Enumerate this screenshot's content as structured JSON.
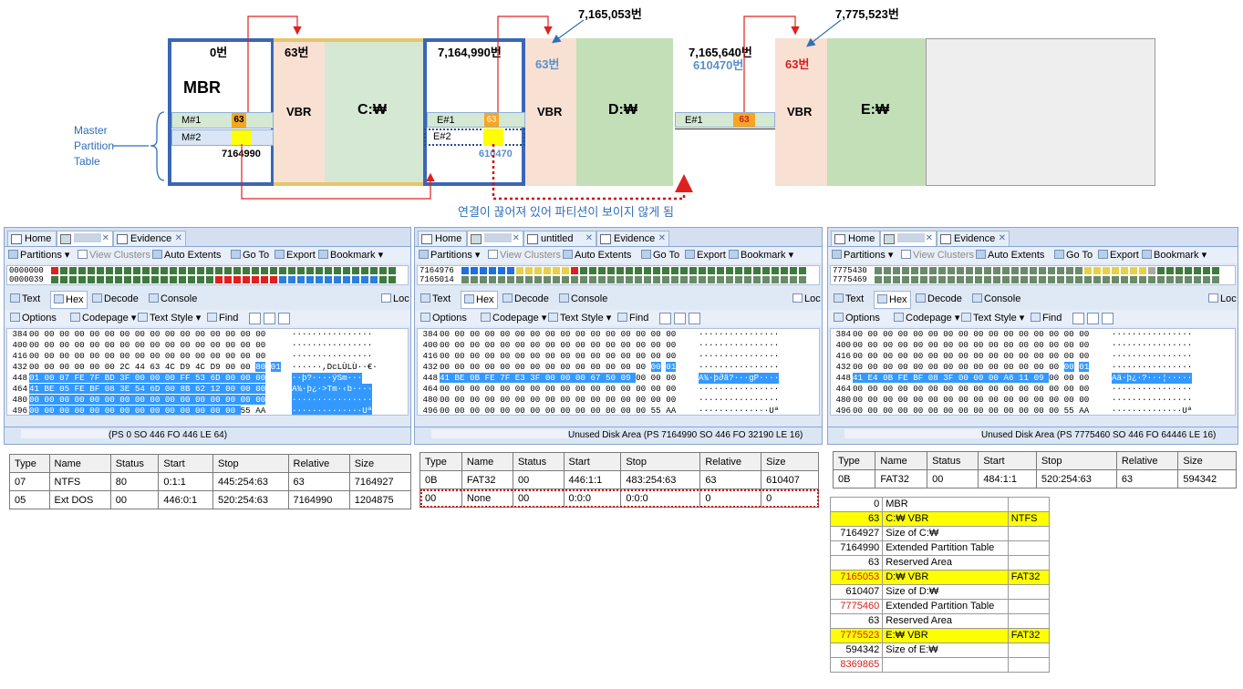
{
  "diagram": {
    "seg1_sector": "0번",
    "mbr_label": "MBR",
    "m1": "M#1",
    "m1_val": "63",
    "m2": "M#2",
    "m2_val": "7164990",
    "master_partition_table": [
      "Master",
      "Partition",
      "Table"
    ],
    "vbr1_sector": "63번",
    "vbr": "VBR",
    "c_drive": "C:₩",
    "seg2_sector": "7,164,990번",
    "e1": "E#1",
    "e1_val": "63",
    "e2": "E#2",
    "e2_val": "610470",
    "d_sector_top": "7,165,053번",
    "d_sector_rel": "63번",
    "d_drive": "D:₩",
    "seg3_sector": "7,165,640번",
    "seg3_rel": "610470번",
    "e1b": "E#1",
    "e1b_val": "63",
    "e_sector_top": "7,775,523번",
    "e_sector_rel": "63번",
    "e_drive": "E:₩",
    "caption": "연결이 끊어져 있어 파티션이 보이지 않게 됨",
    "colors": {
      "frame": "#3a66b5",
      "vbr": "#f8e0d3",
      "drive": "#d5e8d4",
      "green_drive": "#c3dfb8",
      "orange": "#f5a623",
      "yellow": "#ffff00",
      "arrow": "#e02020"
    }
  },
  "panels": [
    {
      "tabs": [
        "Home",
        "",
        "Evidence"
      ],
      "toolbar": [
        "Partitions",
        "View Clusters",
        "Auto Extents",
        "Go To",
        "Export",
        "Bookmark"
      ],
      "map_offsets": [
        "0000000",
        "0000039"
      ],
      "view_tabs": [
        "Text",
        "Hex",
        "Decode",
        "Console",
        "Loc"
      ],
      "hex_toolbar": [
        "Options",
        "Codepage",
        "Text Style",
        "Find"
      ],
      "hex_rows": [
        {
          "off": "384",
          "bytes": "00 00 00 00 00 00 00 00 00 00 00 00 00 00 00 00",
          "ascii": "················",
          "hl": "none"
        },
        {
          "off": "400",
          "bytes": "00 00 00 00 00 00 00 00 00 00 00 00 00 00 00 00",
          "ascii": "················",
          "hl": "none"
        },
        {
          "off": "416",
          "bytes": "00 00 00 00 00 00 00 00 00 00 00 00 00 00 00 00",
          "ascii": "················",
          "hl": "none"
        },
        {
          "off": "432",
          "bytes": "00 00 00 00 00 00 2C 44 63 4C D9 4C D9 00 00 80 01",
          "ascii": "······,DcLÙLÙ··€·",
          "hl": "tail"
        },
        {
          "off": "448",
          "bytes": "01 00 07 FE 7F BD 3F 00 00 00 FF 53 6D 00 00 00",
          "ascii": "··þ?····ÿSm···",
          "hl": "full"
        },
        {
          "off": "464",
          "bytes": "41 BE 05 FE BF 08 3E 54 6D 00 8B 62 12 00 00 00",
          "ascii": "A¾·þ¿·>Tm·‹b····",
          "hl": "full"
        },
        {
          "off": "480",
          "bytes": "00 00 00 00 00 00 00 00 00 00 00 00 00 00 00 00",
          "ascii": "················",
          "hl": "full"
        },
        {
          "off": "496",
          "bytes": "00 00 00 00 00 00 00 00 00 00 00 00 00 00 55 AA",
          "ascii": "··············Uª",
          "hl": "head"
        }
      ],
      "status": "(PS 0 SO 446 FO 446 LE 64)",
      "table": {
        "headers": [
          "Type",
          "Name",
          "Status",
          "Start",
          "Stop",
          "Relative",
          "Size"
        ],
        "rows": [
          [
            "07",
            "NTFS",
            "80",
            "0:1:1",
            "445:254:63",
            "63",
            "7164927"
          ],
          [
            "05",
            "Ext DOS",
            "00",
            "446:0:1",
            "520:254:63",
            "7164990",
            "1204875"
          ]
        ]
      }
    },
    {
      "tabs": [
        "Home",
        "",
        "untitled",
        "Evidence"
      ],
      "toolbar": [
        "Partitions",
        "View Clusters",
        "Auto Extents",
        "Go To",
        "Export",
        "Bookmark"
      ],
      "map_offsets": [
        "7164976",
        "7165014"
      ],
      "view_tabs": [
        "Text",
        "Hex",
        "Decode",
        "Console",
        "Loc"
      ],
      "hex_toolbar": [
        "Options",
        "Codepage",
        "Text Style",
        "Find"
      ],
      "hex_rows": [
        {
          "off": "384",
          "bytes": "00 00 00 00 00 00 00 00 00 00 00 00 00 00 00 00",
          "ascii": "················",
          "hl": "none"
        },
        {
          "off": "400",
          "bytes": "00 00 00 00 00 00 00 00 00 00 00 00 00 00 00 00",
          "ascii": "················",
          "hl": "none"
        },
        {
          "off": "416",
          "bytes": "00 00 00 00 00 00 00 00 00 00 00 00 00 00 00 00",
          "ascii": "················",
          "hl": "none"
        },
        {
          "off": "432",
          "bytes": "00 00 00 00 00 00 00 00 00 00 00 00 00 00 00 01",
          "ascii": "················",
          "hl": "tail"
        },
        {
          "off": "448",
          "bytes": "41 BE 0B FE 7F E3 3F 00 00 00 67 50 09 00 00 00",
          "ascii": "A¾·þ∂ã?···gP····",
          "hl": "part"
        },
        {
          "off": "464",
          "bytes": "00 00 00 00 00 00 00 00 00 00 00 00 00 00 00 00",
          "ascii": "················",
          "hl": "none"
        },
        {
          "off": "480",
          "bytes": "00 00 00 00 00 00 00 00 00 00 00 00 00 00 00 00",
          "ascii": "················",
          "hl": "none"
        },
        {
          "off": "496",
          "bytes": "00 00 00 00 00 00 00 00 00 00 00 00 00 00 55 AA",
          "ascii": "··············Uª",
          "hl": "none"
        }
      ],
      "status": "Unused Disk Area (PS 7164990 SO 446 FO 32190 LE 16)",
      "table": {
        "headers": [
          "Type",
          "Name",
          "Status",
          "Start",
          "Stop",
          "Relative",
          "Size"
        ],
        "rows": [
          [
            "0B",
            "FAT32",
            "00",
            "446:1:1",
            "483:254:63",
            "63",
            "610407"
          ],
          [
            "00",
            "None",
            "00",
            "0:0:0",
            "0:0:0",
            "0",
            "0"
          ]
        ]
      }
    },
    {
      "tabs": [
        "Home",
        "",
        "Evidence"
      ],
      "toolbar": [
        "Partitions",
        "View Clusters",
        "Auto Extents",
        "Go To",
        "Export",
        "Bookmark"
      ],
      "map_offsets": [
        "7775430",
        "7775469"
      ],
      "view_tabs": [
        "Text",
        "Hex",
        "Decode",
        "Console",
        "Loc"
      ],
      "hex_toolbar": [
        "Options",
        "Codepage",
        "Text Style",
        "Find"
      ],
      "hex_rows": [
        {
          "off": "384",
          "bytes": "00 00 00 00 00 00 00 00 00 00 00 00 00 00 00 00",
          "ascii": "················",
          "hl": "none"
        },
        {
          "off": "400",
          "bytes": "00 00 00 00 00 00 00 00 00 00 00 00 00 00 00 00",
          "ascii": "················",
          "hl": "none"
        },
        {
          "off": "416",
          "bytes": "00 00 00 00 00 00 00 00 00 00 00 00 00 00 00 00",
          "ascii": "················",
          "hl": "none"
        },
        {
          "off": "432",
          "bytes": "00 00 00 00 00 00 00 00 00 00 00 00 00 00 00 01",
          "ascii": "················",
          "hl": "tail"
        },
        {
          "off": "448",
          "bytes": "41 E4 0B FE BF 08 3F 00 00 00 A6 11 09 00 00 00",
          "ascii": "Aä·þ¿·?···¦·····",
          "hl": "part"
        },
        {
          "off": "464",
          "bytes": "00 00 00 00 00 00 00 00 00 00 00 00 00 00 00 00",
          "ascii": "················",
          "hl": "none"
        },
        {
          "off": "480",
          "bytes": "00 00 00 00 00 00 00 00 00 00 00 00 00 00 00 00",
          "ascii": "················",
          "hl": "none"
        },
        {
          "off": "496",
          "bytes": "00 00 00 00 00 00 00 00 00 00 00 00 00 00 55 AA",
          "ascii": "··············Uª",
          "hl": "none"
        }
      ],
      "status": "Unused Disk Area (PS 7775460 SO 446 FO 64446 LE 16)",
      "table": {
        "headers": [
          "Type",
          "Name",
          "Status",
          "Start",
          "Stop",
          "Relative",
          "Size"
        ],
        "rows": [
          [
            "0B",
            "FAT32",
            "00",
            "484:1:1",
            "520:254:63",
            "63",
            "594342"
          ]
        ]
      }
    }
  ],
  "sector_map": [
    {
      "num": "0",
      "desc": "MBR",
      "fs": "",
      "yellow": false,
      "red": false
    },
    {
      "num": "63",
      "desc": "C:₩ VBR",
      "fs": "NTFS",
      "yellow": true,
      "red": false
    },
    {
      "num": "7164927",
      "desc": "Size of C:₩",
      "fs": "",
      "yellow": false,
      "red": false
    },
    {
      "num": "7164990",
      "desc": "Extended Partition Table",
      "fs": "",
      "yellow": false,
      "red": false
    },
    {
      "num": "63",
      "desc": "Reserved Area",
      "fs": "",
      "yellow": false,
      "red": false
    },
    {
      "num": "7165053",
      "desc": "D:₩ VBR",
      "fs": "FAT32",
      "yellow": true,
      "red": true
    },
    {
      "num": "610407",
      "desc": "Size of D:₩",
      "fs": "",
      "yellow": false,
      "red": false
    },
    {
      "num": "7775460",
      "desc": "Extended Partition Table",
      "fs": "",
      "yellow": false,
      "red": true
    },
    {
      "num": "63",
      "desc": "Reserved Area",
      "fs": "",
      "yellow": false,
      "red": false
    },
    {
      "num": "7775523",
      "desc": "E:₩ VBR",
      "fs": "FAT32",
      "yellow": true,
      "red": true
    },
    {
      "num": "594342",
      "desc": "Size of E:₩",
      "fs": "",
      "yellow": false,
      "red": false
    },
    {
      "num": "8369865",
      "desc": "",
      "fs": "",
      "yellow": false,
      "red": true
    }
  ]
}
